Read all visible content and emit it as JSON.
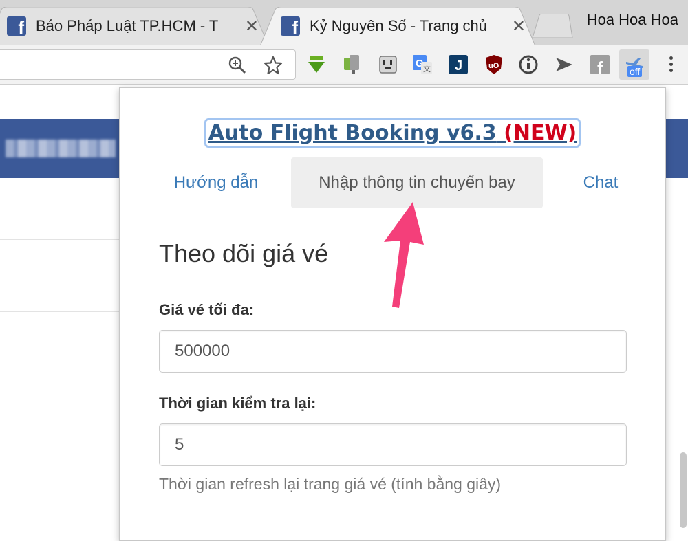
{
  "browser": {
    "tabs": [
      {
        "title": "Báo Pháp Luật TP.HCM - T",
        "favicon": "facebook-icon",
        "active": false
      },
      {
        "title": "Kỷ Nguyên Số - Trang chủ",
        "favicon": "facebook-icon",
        "active": true
      }
    ],
    "profile_name": "Hoa Hoa Hoa",
    "close_glyph": "✕",
    "extension_badge": "off"
  },
  "popup": {
    "title": "Auto Flight Booking v6.3",
    "title_new": "(NEW)",
    "nav": [
      {
        "label": "Hướng dẫn"
      },
      {
        "label": "Nhập thông tin chuyến bay",
        "active": true
      },
      {
        "label": "Chat"
      }
    ],
    "section_heading": "Theo dõi giá vé",
    "max_price_label": "Giá vé tối đa:",
    "max_price_value": "500000",
    "recheck_label": "Thời gian kiểm tra lại:",
    "recheck_value": "5",
    "recheck_help": "Thời gian refresh lại trang giá vé (tính bằng giây)"
  },
  "colors": {
    "accent_link": "#3a7ab7",
    "title_color": "#2f5b89",
    "new_red": "#d0021b",
    "annotation_arrow": "#f43f7a",
    "facebook_blue": "#3b5998"
  }
}
